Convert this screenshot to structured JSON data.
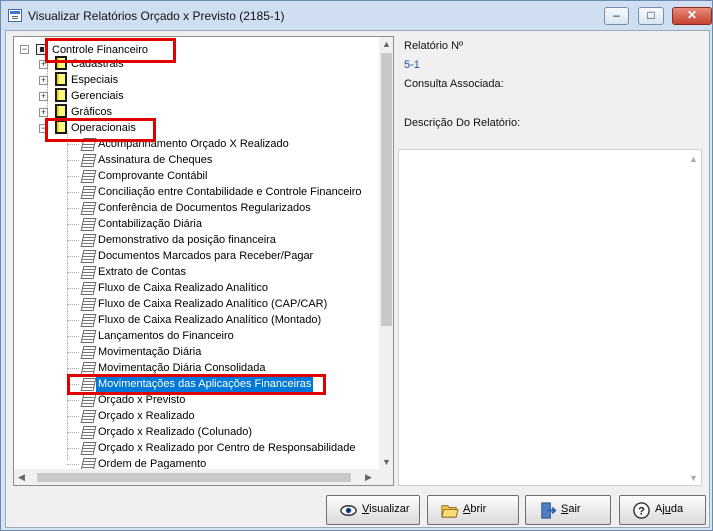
{
  "window": {
    "title": "Visualizar Relatórios Orçado x Previsto (2185-1)",
    "controls": {
      "minimize": "–",
      "maximize": "□",
      "close": "✕"
    }
  },
  "tree": {
    "root": "Controle Financeiro",
    "groups": [
      "Cadastrais",
      "Especiais",
      "Gerenciais",
      "Gráficos",
      "Operacionais"
    ],
    "reports": [
      "Acompanhamento Orçado X Realizado",
      "Assinatura de Cheques",
      "Comprovante Contábil",
      "Conciliação entre Contabilidade e Controle Financeiro",
      "Conferência de Documentos Regularizados",
      "Contabilização Diária",
      "Demonstrativo da posição financeira",
      "Documentos Marcados para Receber/Pagar",
      "Extrato de Contas",
      "Fluxo de Caixa Realizado Analítico",
      "Fluxo de Caixa Realizado Analítico (CAP/CAR)",
      "Fluxo de Caixa Realizado Analítico (Montado)",
      "Lançamentos do Financeiro",
      "Movimentação Diária",
      "Movimentação Diária Consolidada",
      "Movimentações das Aplicações Financeiras",
      "Orçado x Previsto",
      "Orçado x Realizado",
      "Orçado x Realizado (Colunado)",
      "Orçado x Realizado por Centro de Responsabilidade",
      "Ordem de Pagamento"
    ],
    "selected_index": 15,
    "expander_open": "−",
    "expander_closed": "+"
  },
  "details": {
    "report_number_label": "Relatório Nº",
    "report_number": "5-1",
    "associated_query_label": "Consulta Associada:",
    "description_label": "Descrição Do Relatório:"
  },
  "buttons": {
    "view": {
      "mnemonic": "V",
      "rest": "isualizar"
    },
    "open": {
      "mnemonic": "A",
      "rest": "brir"
    },
    "exit": {
      "mnemonic": "S",
      "rest": "air"
    },
    "help": {
      "prefix": "Aj",
      "mnemonic": "u",
      "rest": "da"
    }
  },
  "icons": {
    "tree_root": "monitor-icon",
    "group": "folder-icon",
    "report": "report-icon",
    "view": "eye-icon",
    "open": "folder-open-icon",
    "exit": "exit-door-icon",
    "help": "question-icon"
  },
  "colors": {
    "selection": "#0078d7",
    "highlight_boxes": "#e00000"
  }
}
